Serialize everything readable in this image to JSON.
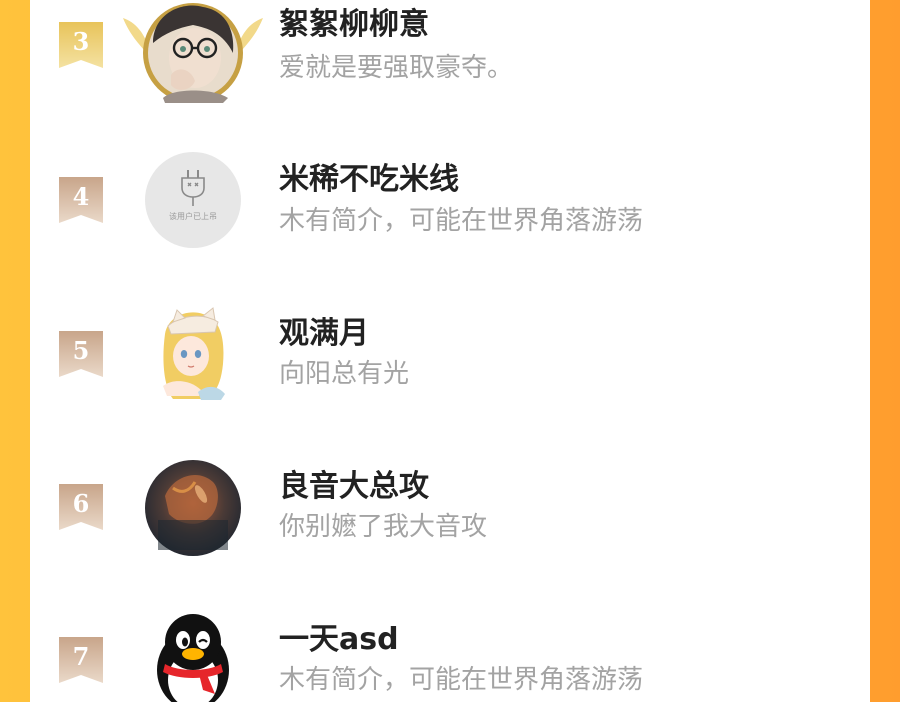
{
  "colors": {
    "background_left": "#ffc33c",
    "background_right": "#ff9d2e",
    "panel": "#ffffff",
    "rank_gold": "#e6c767",
    "rank_bronze": "#cfae93",
    "name": "#222222",
    "bio": "#a3a3a3"
  },
  "ranking": {
    "items": [
      {
        "rank": "3",
        "name": "絮絮柳柳意",
        "bio": "爱就是要强取豪夺。",
        "avatar": "anime-man-glasses-avatar",
        "frame": "gold-winged-frame"
      },
      {
        "rank": "4",
        "name": "米稀不吃米线",
        "bio": "木有简介，可能在世界角落游荡",
        "avatar": "default-plug-avatar",
        "avatar_label": "该用户已上吊"
      },
      {
        "rank": "5",
        "name": "观满月",
        "bio": "向阳总有光",
        "avatar": "anime-girl-cat-hat-avatar"
      },
      {
        "rank": "6",
        "name": "良音大总攻",
        "bio": "你别嬷了我大音攻",
        "avatar": "dark-photo-avatar"
      },
      {
        "rank": "7",
        "name": "一天asd",
        "bio": "木有简介，可能在世界角落游荡",
        "avatar": "qq-penguin-avatar"
      }
    ]
  }
}
